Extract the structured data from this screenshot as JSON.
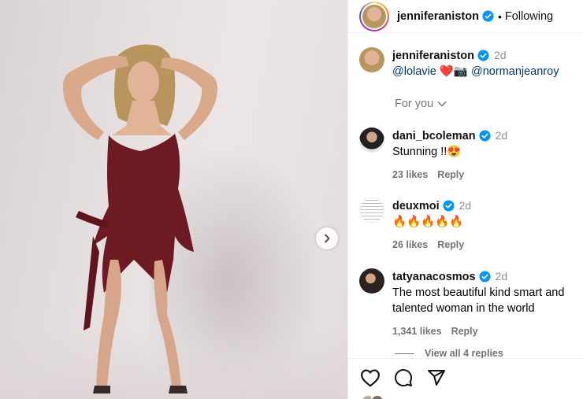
{
  "post": {
    "author": "jenniferaniston",
    "follow_status": "Following",
    "separator": "•"
  },
  "caption": {
    "author": "jenniferaniston",
    "time": "2d",
    "mention_1": "@lolavie",
    "emoji": "❤️📷",
    "mention_2": "@normanjeanroy"
  },
  "sort": {
    "label": "For you"
  },
  "comments": [
    {
      "user": "dani_bcoleman",
      "time": "2d",
      "text": "Stunning !!😍",
      "likes": "23 likes",
      "reply": "Reply"
    },
    {
      "user": "deuxmoi",
      "time": "2d",
      "text": "🔥🔥🔥🔥🔥",
      "likes": "26 likes",
      "reply": "Reply"
    },
    {
      "user": "tatyanacosmos",
      "time": "2d",
      "text": "The most beautiful kind smart and talented woman in the world",
      "likes": "1,341 likes",
      "reply": "Reply"
    }
  ],
  "view_replies": "View all 4 replies",
  "icons": {
    "verified": "verified-badge-icon",
    "next": "chevron-right-icon",
    "like": "heart-icon",
    "comment": "comment-icon",
    "share": "send-icon",
    "sort": "chevron-down-icon"
  },
  "colors": {
    "verified": "#0095f6",
    "mention": "#00376b",
    "dress": "#6e1a22",
    "muted": "#737373"
  }
}
